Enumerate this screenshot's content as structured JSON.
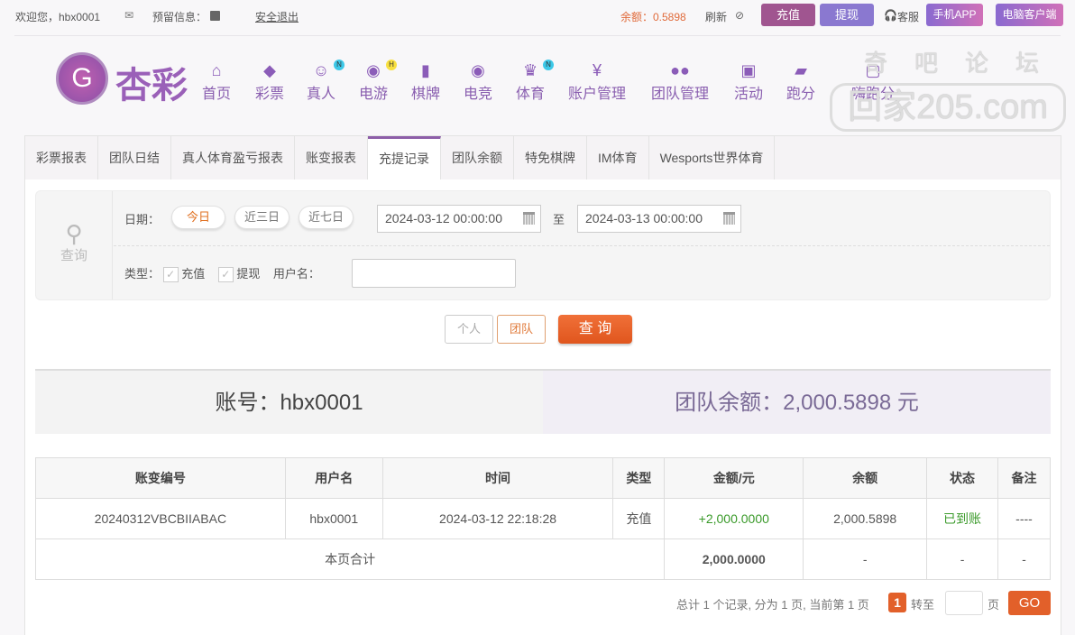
{
  "topbar": {
    "welcome": "欢迎您，hbx0001",
    "reserved_label": "预留信息：",
    "logout": "安全退出",
    "balance": "余额：0.5898",
    "refresh": "刷新",
    "recharge": "充值",
    "withdraw": "提现",
    "service": "客服",
    "mobile_app": "手机APP",
    "pc_client": "电脑客户端"
  },
  "logo": {
    "text": "杏彩"
  },
  "watermark": {
    "line1": "奇吧论坛",
    "line2": "回家205.com"
  },
  "nav": [
    {
      "label": "首页",
      "icon": "home-icon"
    },
    {
      "label": "彩票",
      "icon": "ticket-icon"
    },
    {
      "label": "真人",
      "icon": "dealer-icon",
      "badge": "N"
    },
    {
      "label": "电游",
      "icon": "gamepad-icon",
      "badge": "H"
    },
    {
      "label": "棋牌",
      "icon": "cards-icon"
    },
    {
      "label": "电竞",
      "icon": "gamepad-icon"
    },
    {
      "label": "体育",
      "icon": "trophy-icon",
      "badge": "N"
    },
    {
      "label": "账户管理",
      "icon": "yuan-icon"
    },
    {
      "label": "团队管理",
      "icon": "team-icon"
    },
    {
      "label": "活动",
      "icon": "gift-icon"
    },
    {
      "label": "跑分",
      "icon": "rhino-icon"
    },
    {
      "label": "嗨跑分",
      "icon": "app-icon"
    }
  ],
  "tabs": [
    "彩票报表",
    "团队日结",
    "真人体育盈亏报表",
    "账变报表",
    "充提记录",
    "团队余额",
    "特免棋牌",
    "IM体育",
    "Wesports世界体育"
  ],
  "active_tab": "充提记录",
  "filter": {
    "query_label": "查询",
    "date_label": "日期：",
    "today": "今日",
    "three_days": "近三日",
    "seven_days": "近七日",
    "start": "2024-03-12 00:00:00",
    "to": "至",
    "end": "2024-03-13 00:00:00",
    "type_label": "类型：",
    "type_recharge": "充值",
    "type_withdraw": "提现",
    "username_label": "用户名：",
    "username_value": ""
  },
  "buttons": {
    "personal": "个人",
    "team": "团队",
    "query": "查 询"
  },
  "account": {
    "account": "账号：hbx0001",
    "team_balance": "团队余额：2,000.5898 元"
  },
  "table": {
    "headers": [
      "账变编号",
      "用户名",
      "时间",
      "类型",
      "金额/元",
      "余额",
      "状态",
      "备注"
    ],
    "rows": [
      [
        "20240312VBCBIIABAC",
        "hbx0001",
        "2024-03-12 22:18:28",
        "充值",
        "+2,000.0000",
        "2,000.5898",
        "已到账",
        "----"
      ]
    ],
    "total": {
      "label": "本页合计",
      "amount": "2,000.0000",
      "balance": "-",
      "status": "-",
      "note": "-"
    }
  },
  "pagination": {
    "summary": "总计 1 个记录, 分为 1 页, 当前第 1 页",
    "current": "1",
    "goto": "转至",
    "page": "页",
    "go": "GO"
  },
  "colors": {
    "purple": "#8d5ea8",
    "orange": "#e8602c",
    "green": "#3a9a2a"
  }
}
